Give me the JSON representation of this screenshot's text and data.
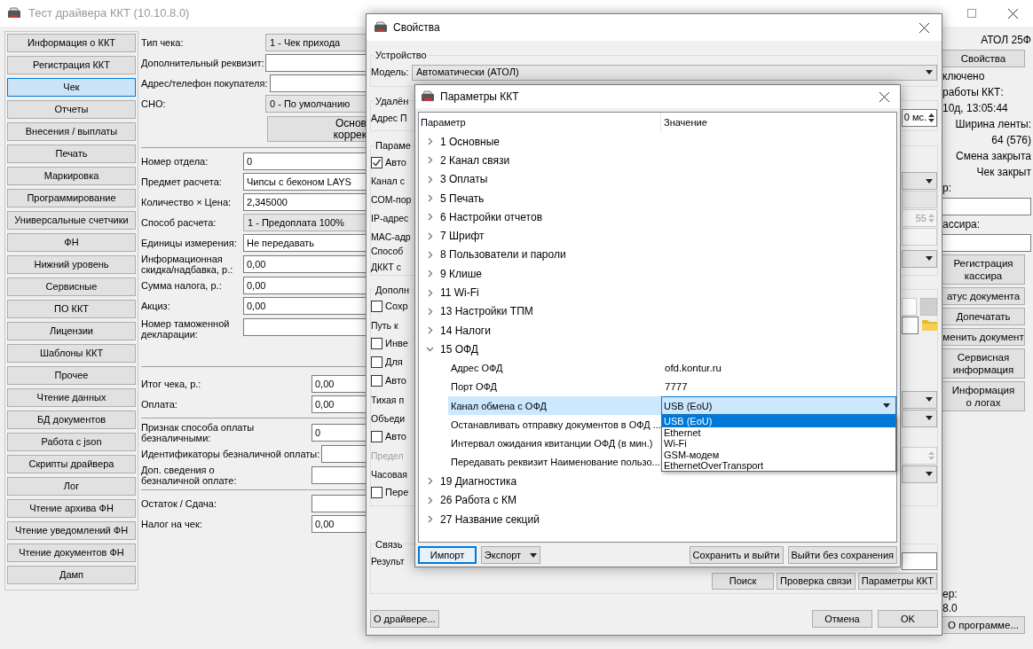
{
  "main_window": {
    "title": "Тест драйвера ККТ (10.10.8.0)",
    "nav": [
      {
        "label": "Информация о ККТ",
        "selected": false
      },
      {
        "label": "Регистрация ККТ",
        "selected": false
      },
      {
        "label": "Чек",
        "selected": true
      },
      {
        "label": "Отчеты",
        "selected": false
      },
      {
        "label": "Внесения / выплаты",
        "selected": false
      },
      {
        "label": "Печать",
        "selected": false
      },
      {
        "label": "Маркировка",
        "selected": false
      },
      {
        "label": "Программирование",
        "selected": false
      },
      {
        "label": "Универсальные счетчики",
        "selected": false
      },
      {
        "label": "ФН",
        "selected": false
      },
      {
        "label": "Нижний уровень",
        "selected": false
      },
      {
        "label": "Сервисные",
        "selected": false
      },
      {
        "label": "ПО ККТ",
        "selected": false
      },
      {
        "label": "Лицензии",
        "selected": false
      },
      {
        "label": "Шаблоны ККТ",
        "selected": false
      },
      {
        "label": "Прочее",
        "selected": false
      },
      {
        "label": "Чтение данных",
        "selected": false
      },
      {
        "label": "БД документов",
        "selected": false
      },
      {
        "label": "Работа с json",
        "selected": false
      },
      {
        "label": "Скрипты драйвера",
        "selected": false
      },
      {
        "label": "Лог",
        "selected": false
      },
      {
        "label": "Чтение архива ФН",
        "selected": false
      },
      {
        "label": "Чтение уведомлений ФН",
        "selected": false
      },
      {
        "label": "Чтение документов ФН",
        "selected": false
      },
      {
        "label": "Дамп",
        "selected": false
      }
    ],
    "form": [
      {
        "kind": "header",
        "rows": [
          {
            "kind": "combo",
            "label": "Тип чека:",
            "value": "1 - Чек прихода"
          },
          {
            "kind": "field",
            "label": "Дополнительный реквизит:"
          },
          {
            "kind": "field",
            "label": "Адрес/телефон покупателя:"
          },
          {
            "kind": "combo",
            "label": "СНО:",
            "value": "0 - По умолчанию"
          },
          {
            "kind": "button",
            "lines": [
              "Основ",
              "коррек"
            ]
          }
        ]
      },
      {
        "kind": "item",
        "rows": [
          {
            "kind": "field",
            "label": "Номер отдела:",
            "value": "0"
          },
          {
            "kind": "field",
            "label": "Предмет расчета:",
            "value": "Чипсы с беконом LAYS"
          },
          {
            "kind": "field",
            "label": "Количество × Цена:",
            "value": "2,345000"
          },
          {
            "kind": "combo",
            "label": "Способ расчета:",
            "value": "1 - Предоплата 100%"
          },
          {
            "kind": "field",
            "label": "Единицы измерения:",
            "value": "Не передавать"
          },
          {
            "kind": "field",
            "label": "Информационная\nскидка/надбавка, р.:",
            "value": "0,00"
          },
          {
            "kind": "field",
            "label": "Сумма налога, р.:",
            "value": "0,00"
          },
          {
            "kind": "field",
            "label": "Акциз:",
            "value": "0,00"
          },
          {
            "kind": "area",
            "label": "Номер таможенной\nдекларации:"
          }
        ]
      },
      {
        "kind": "totals",
        "rows": [
          {
            "kind": "field",
            "label": "Итог чека, р.:",
            "value": "0,00"
          },
          {
            "kind": "field",
            "label": "Оплата:",
            "value": "0,00"
          }
        ]
      },
      {
        "kind": "totals",
        "rows": [
          {
            "kind": "field",
            "label": "Признак способа оплаты\nбезналичными:",
            "value": "0"
          },
          {
            "kind": "field",
            "label": "Идентификаторы безналичной оплаты:"
          },
          {
            "kind": "field",
            "label": "Доп. сведения о\nбезналичной оплате:"
          }
        ]
      },
      {
        "kind": "totals",
        "rows": [
          {
            "kind": "field",
            "label": "Остаток / Сдача:"
          },
          {
            "kind": "field",
            "label": "Налог на чек:",
            "value": "0,00"
          }
        ]
      }
    ],
    "status_panel": {
      "top": [
        {
          "kind": "status",
          "text": "АТОЛ 25Ф"
        },
        {
          "kind": "button",
          "text": "Свойства"
        },
        {
          "kind": "label",
          "text": "ключено"
        },
        {
          "kind": "label",
          "text": "работы ККТ:"
        },
        {
          "kind": "label",
          "text": "10д, 13:05:44"
        },
        {
          "kind": "status",
          "text": "Ширина ленты:"
        },
        {
          "kind": "status",
          "text": "64 (576)"
        },
        {
          "kind": "status",
          "text": "Смена закрыта"
        },
        {
          "kind": "status",
          "text": "Чек закрыт"
        },
        {
          "kind": "label",
          "text": "р:"
        },
        {
          "kind": "field"
        },
        {
          "kind": "label",
          "text": "ассира:"
        },
        {
          "kind": "field"
        },
        {
          "kind": "button",
          "text": "Регистрация\nкассира"
        },
        {
          "kind": "button",
          "text": "атус документа"
        },
        {
          "kind": "button",
          "text": "Допечатать"
        },
        {
          "kind": "button",
          "text": "менить документ"
        },
        {
          "kind": "button",
          "text": "Сервисная\nинформация"
        },
        {
          "kind": "button",
          "text": "Информация\nо логах"
        }
      ],
      "bottom": [
        {
          "kind": "label",
          "text": "ер:"
        },
        {
          "kind": "label",
          "text": "8.0"
        },
        {
          "kind": "button",
          "text": "О программе..."
        }
      ]
    }
  },
  "properties_dialog": {
    "title": "Свойства",
    "groups": [
      {
        "title": "Устройство",
        "rows": [
          {
            "kind": "wide_combo",
            "label": "Модель:",
            "value": "Автоматически (АТОЛ)"
          }
        ]
      },
      {
        "title": "Удалён",
        "rows": [
          {
            "kind": "label",
            "label": "Адрес П",
            "control": {
              "kind": "spin",
              "value": "0 мс."
            }
          }
        ]
      },
      {
        "title": "Параме",
        "rows": [
          {
            "kind": "checkbox",
            "label": "Авто",
            "checked": true
          },
          {
            "kind": "label",
            "label": "Канал с",
            "control": {
              "kind": "combo"
            }
          },
          {
            "kind": "label",
            "label": "COM-пор",
            "control": {
              "kind": "combo",
              "disabled": true
            }
          },
          {
            "kind": "label",
            "label": "IP-адрес",
            "control": {
              "kind": "spin",
              "value": "55",
              "disabled": true
            }
          },
          {
            "kind": "label",
            "label": "MAC-адр",
            "control": {
              "kind": "field",
              "disabled": true
            }
          },
          {
            "kind": "label",
            "label": "Способ\nДККТ с",
            "control": {
              "kind": "combo"
            }
          }
        ]
      },
      {
        "title": "Дополн",
        "rows": [
          {
            "kind": "checkbox",
            "label": "Сохр",
            "checked": false,
            "control": {
              "kind": "field_button"
            }
          },
          {
            "kind": "label",
            "label": "Путь к",
            "control": {
              "kind": "field_folder"
            }
          },
          {
            "kind": "checkbox",
            "label": "Инве",
            "checked": false
          },
          {
            "kind": "checkbox",
            "label": "Для",
            "checked": false
          },
          {
            "kind": "checkbox",
            "label": "Авто",
            "checked": false
          },
          {
            "kind": "label",
            "label": "Тихая п",
            "control": {
              "kind": "combo"
            }
          },
          {
            "kind": "label",
            "label": "Объеди",
            "control": {
              "kind": "combo"
            }
          },
          {
            "kind": "checkbox",
            "label": "Авто",
            "checked": false
          },
          {
            "kind": "label",
            "label": "Предел",
            "disabled": true,
            "control": {
              "kind": "spin",
              "disabled": true
            }
          },
          {
            "kind": "label",
            "label": "Часовая",
            "control": {
              "kind": "combo"
            }
          },
          {
            "kind": "checkbox",
            "label": "Пере",
            "checked": false
          }
        ]
      },
      {
        "title": "Связь",
        "rows": [
          {
            "kind": "label",
            "label": "Результ",
            "control": {
              "kind": "field"
            }
          }
        ],
        "buttons": [
          "Поиск",
          "Проверка связи",
          "Параметры ККТ"
        ]
      }
    ],
    "footer_left": "О драйвере...",
    "footer_buttons": [
      "Отмена",
      "OK"
    ]
  },
  "params_dialog": {
    "title": "Параметры ККТ",
    "columns": [
      "Параметр",
      "Значение"
    ],
    "tree": [
      {
        "label": "1 Основные",
        "expanded": false,
        "selected": false
      },
      {
        "label": "2 Канал связи",
        "expanded": false,
        "selected": false
      },
      {
        "label": "3 Оплаты",
        "expanded": false,
        "selected": false
      },
      {
        "label": "5 Печать",
        "expanded": false,
        "selected": false
      },
      {
        "label": "6 Настройки отчетов",
        "expanded": false,
        "selected": false
      },
      {
        "label": "7 Шрифт",
        "expanded": false,
        "selected": false
      },
      {
        "label": "8 Пользователи и пароли",
        "expanded": false,
        "selected": false
      },
      {
        "label": "9 Клише",
        "expanded": false,
        "selected": false
      },
      {
        "label": "11 Wi-Fi",
        "expanded": false,
        "selected": false
      },
      {
        "label": "13 Настройки ТПМ",
        "expanded": false,
        "selected": false
      },
      {
        "label": "14 Налоги",
        "expanded": false,
        "selected": false
      },
      {
        "label": "15 ОФД",
        "expanded": true,
        "selected": false,
        "children": [
          {
            "name": "Адрес ОФД",
            "value": "ofd.kontur.ru",
            "selected": false
          },
          {
            "name": "Порт ОФД",
            "value": "7777",
            "selected": false
          },
          {
            "name": "Канал обмена с ОФД",
            "value": "USB (EoU)",
            "selected": true,
            "options": [
              {
                "label": "USB (EoU)",
                "selected": true
              },
              {
                "label": "Ethernet",
                "selected": false
              },
              {
                "label": "Wi-Fi",
                "selected": false
              },
              {
                "label": "GSM-модем",
                "selected": false
              },
              {
                "label": "EthernetOverTransport",
                "selected": false
              }
            ]
          },
          {
            "name": "Останавливать отправку документов в ОФД ...",
            "selected": false
          },
          {
            "name": "Интервал ожидания квитанции ОФД (в мин.)",
            "selected": false
          },
          {
            "name": "Передавать реквизит Наименование пользо...",
            "selected": false
          }
        ]
      },
      {
        "label": "19 Диагностика",
        "expanded": false,
        "selected": false
      },
      {
        "label": "26 Работа с КМ",
        "expanded": false,
        "selected": false
      },
      {
        "label": "27 Название секций",
        "expanded": false,
        "selected": false
      }
    ],
    "buttons": [
      {
        "label": "Импорт",
        "kind": "focused"
      },
      {
        "label": "Экспорт",
        "kind": "menu"
      },
      {
        "label": "Сохранить и выйти",
        "kind": "plain"
      },
      {
        "label": "Выйти без сохранения",
        "kind": "plain"
      }
    ]
  }
}
